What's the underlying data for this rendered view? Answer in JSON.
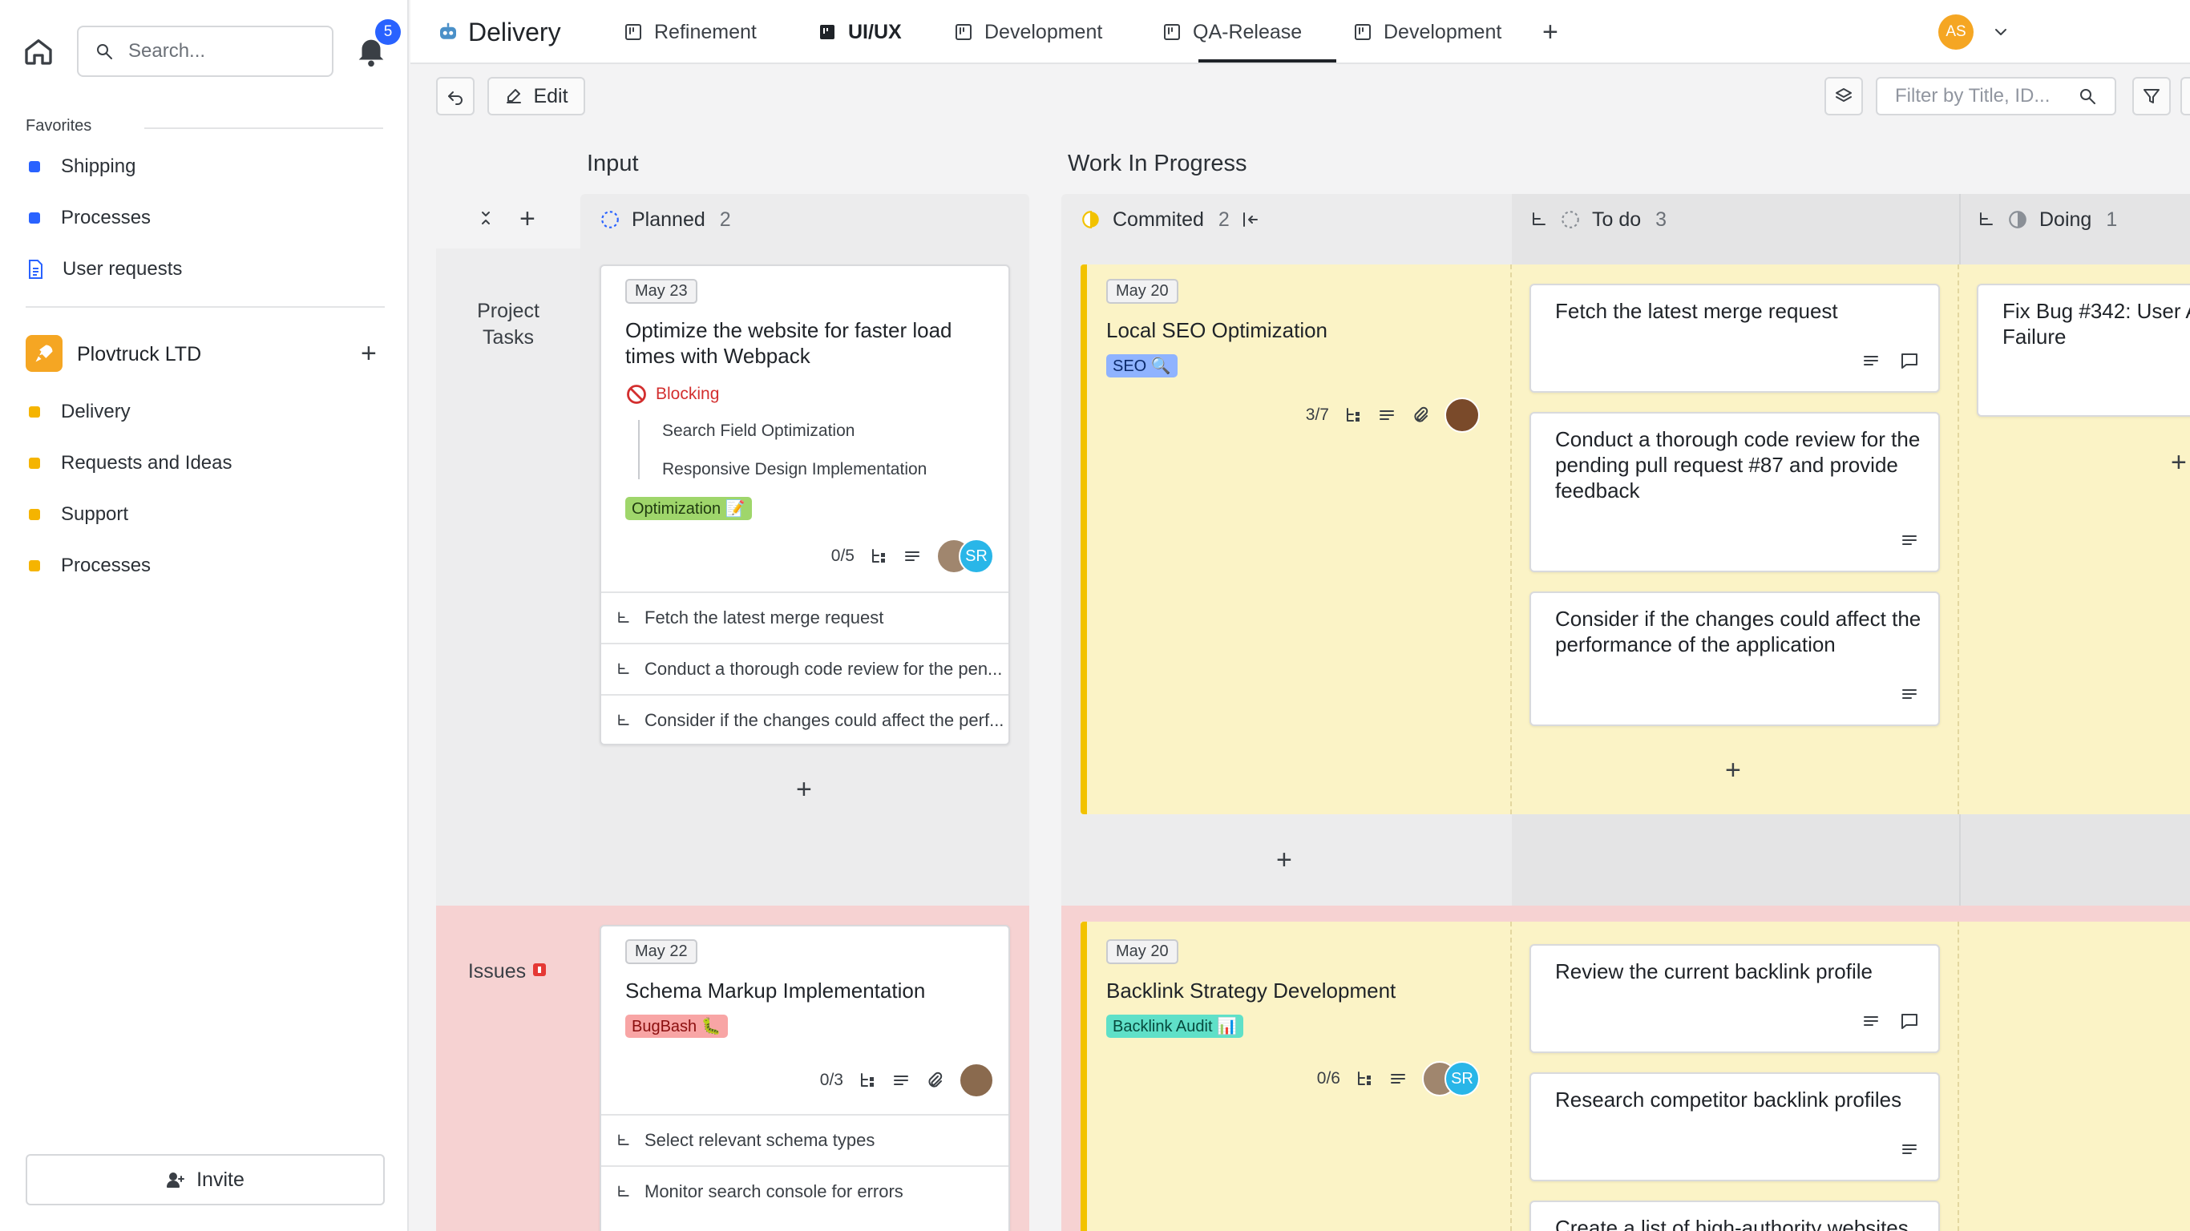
{
  "sidebar": {
    "search_placeholder": "Search...",
    "notifications_count": "5",
    "favorites_label": "Favorites",
    "favorites": [
      {
        "label": "Shipping",
        "color": "#2962ff"
      },
      {
        "label": "Processes",
        "color": "#2962ff"
      },
      {
        "label": "User requests",
        "icon": "document-icon"
      }
    ],
    "workspace": {
      "name": "Plovtruck LTD",
      "color": "#f5a623"
    },
    "workspace_items": [
      {
        "label": "Delivery",
        "color": "#f5b400"
      },
      {
        "label": "Requests and Ideas",
        "color": "#f5b400"
      },
      {
        "label": "Support",
        "color": "#f5b400"
      },
      {
        "label": "Processes",
        "color": "#f5b400"
      }
    ],
    "invite_label": "Invite"
  },
  "topbar": {
    "project_title": "Delivery",
    "tabs": [
      {
        "label": "Refinement"
      },
      {
        "label": "UI/UX",
        "active": true
      },
      {
        "label": "Development"
      },
      {
        "label": "QA-Release"
      },
      {
        "label": "Development"
      }
    ],
    "user_initials": "AS",
    "user_color": "#f5a623"
  },
  "toolbar": {
    "edit_label": "Edit",
    "filter_placeholder": "Filter by Title, ID..."
  },
  "board": {
    "input_title": "Input",
    "wip_title": "Work In Progress",
    "columns": {
      "planned": {
        "label": "Planned",
        "count": "2"
      },
      "committed": {
        "label": "Commited",
        "count": "2"
      },
      "todo": {
        "label": "To do",
        "count": "3"
      },
      "doing": {
        "label": "Doing",
        "count": "1"
      }
    },
    "swimlanes": [
      {
        "label": "Project\nTasks"
      },
      {
        "label": "Issues"
      }
    ],
    "cards": {
      "c1": {
        "date": "May 23",
        "title": "Optimize the website for faster load times with Webpack",
        "status": "Blocking",
        "children": [
          "Search Field Optimization",
          "Responsive Design Implementation"
        ],
        "tag": "Optimization 📝",
        "progress": "0/5",
        "assignee": "SR",
        "subtasks": [
          "Fetch the latest merge request",
          "Conduct a thorough code review for the pen...",
          "Consider if the changes could affect the perf..."
        ]
      },
      "c2": {
        "date": "May 20",
        "title": "Local SEO Optimization",
        "tag": "SEO 🔍",
        "progress": "3/7"
      },
      "t1": {
        "title": "Fetch the latest merge request"
      },
      "t2": {
        "title": "Conduct a thorough code review for the pending pull request #87 and provide feedback"
      },
      "t3": {
        "title": "Consider if the changes could affect the performance of the application"
      },
      "d1": {
        "title": "Fix Bug #342: User A Failure"
      },
      "c3": {
        "date": "May 22",
        "title": "Schema Markup Implementation",
        "tag": "BugBash 🐛",
        "progress": "0/3",
        "subtasks": [
          "Select relevant schema types",
          "Monitor search console for errors"
        ]
      },
      "c4": {
        "date": "May 20",
        "title": "Backlink Strategy Development",
        "tag": "Backlink Audit 📊",
        "progress": "0/6",
        "assignee": "SR"
      },
      "t4": {
        "title": "Review the current backlink profile"
      },
      "t5": {
        "title": "Research competitor backlink profiles"
      },
      "t6": {
        "title": "Create a list of high-authority websites"
      }
    }
  }
}
